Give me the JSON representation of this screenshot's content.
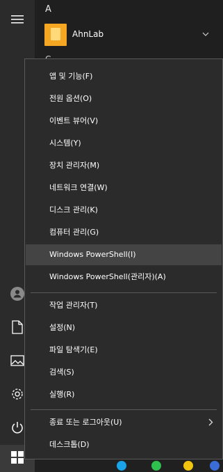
{
  "app_list": {
    "letter_a": "A",
    "app_name": "AhnLab",
    "letter_c": "C"
  },
  "menu": {
    "items": [
      {
        "label": "앱 및 기능(F)"
      },
      {
        "label": "전원 옵션(O)"
      },
      {
        "label": "이벤트 뷰어(V)"
      },
      {
        "label": "시스템(Y)"
      },
      {
        "label": "장치 관리자(M)"
      },
      {
        "label": "네트워크 연결(W)"
      },
      {
        "label": "디스크 관리(K)"
      },
      {
        "label": "컴퓨터 관리(G)"
      },
      {
        "label": "Windows PowerShell(I)"
      },
      {
        "label": "Windows PowerShell(관리자)(A)"
      },
      {
        "label": "작업 관리자(T)"
      },
      {
        "label": "설정(N)"
      },
      {
        "label": "파일 탐색기(E)"
      },
      {
        "label": "검색(S)"
      },
      {
        "label": "실행(R)"
      },
      {
        "label": "종료 또는 로그아웃(U)"
      },
      {
        "label": "데스크톱(D)"
      }
    ]
  },
  "colors": {
    "menu_bg": "#2b2b2b",
    "highlight": "#444444",
    "app_tile": "#f5a623"
  },
  "icons": [
    "hamburger-icon",
    "user-icon",
    "document-icon",
    "pictures-icon",
    "gear-icon",
    "power-icon",
    "windows-logo-icon",
    "chevron-down-icon",
    "chevron-right-icon"
  ]
}
